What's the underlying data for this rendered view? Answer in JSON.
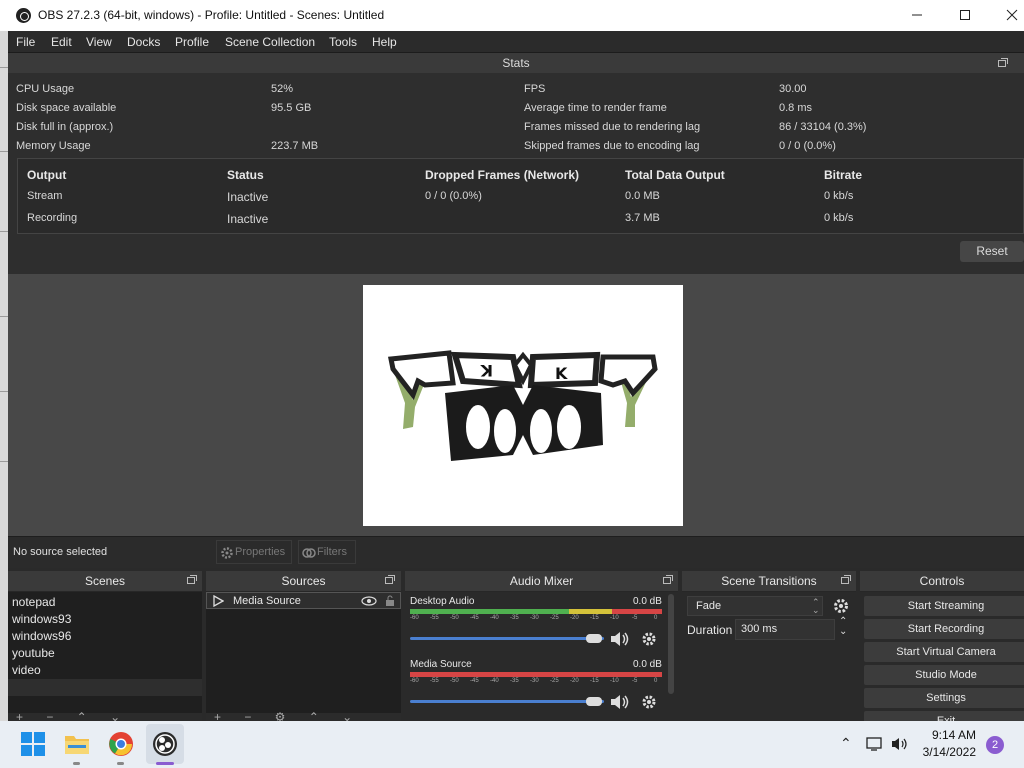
{
  "window": {
    "title": "OBS 27.2.3 (64-bit, windows) - Profile: Untitled - Scenes: Untitled"
  },
  "menu": [
    "File",
    "Edit",
    "View",
    "Docks",
    "Profile",
    "Scene Collection",
    "Tools",
    "Help"
  ],
  "stats": {
    "header": "Stats",
    "left": [
      {
        "label": "CPU Usage",
        "value": "52%"
      },
      {
        "label": "Disk space available",
        "value": "95.5 GB"
      },
      {
        "label": "Disk full in (approx.)",
        "value": ""
      },
      {
        "label": "Memory Usage",
        "value": "223.7 MB"
      }
    ],
    "right": [
      {
        "label": "FPS",
        "value": "30.00"
      },
      {
        "label": "Average time to render frame",
        "value": "0.8 ms"
      },
      {
        "label": "Frames missed due to rendering lag",
        "value": "86 / 33104 (0.3%)"
      },
      {
        "label": "Skipped frames due to encoding lag",
        "value": "0 / 0 (0.0%)"
      }
    ],
    "table": {
      "headers": [
        "Output",
        "Status",
        "Dropped Frames (Network)",
        "Total Data Output",
        "Bitrate"
      ],
      "rows": [
        [
          "Stream",
          "Inactive",
          "0 / 0 (0.0%)",
          "0.0 MB",
          "0 kb/s"
        ],
        [
          "Recording",
          "Inactive",
          "",
          "3.7 MB",
          "0 kb/s"
        ]
      ]
    },
    "reset_label": "Reset"
  },
  "source_toolbar": {
    "no_source": "No source selected",
    "properties": "Properties",
    "filters": "Filters"
  },
  "scenes": {
    "title": "Scenes",
    "items": [
      "notepad",
      "windows93",
      "windows96",
      "youtube",
      "video"
    ],
    "selected": "video"
  },
  "sources": {
    "title": "Sources",
    "items": [
      {
        "name": "Media Source"
      }
    ]
  },
  "audio_mixer": {
    "title": "Audio Mixer",
    "channels": [
      {
        "name": "Desktop Audio",
        "db": "0.0 dB",
        "volume": 1.0
      },
      {
        "name": "Media Source",
        "db": "0.0 dB",
        "volume": 1.0
      }
    ],
    "scale": [
      "-60",
      "-55",
      "-50",
      "-45",
      "-40",
      "-35",
      "-30",
      "-25",
      "-20",
      "-15",
      "-10",
      "-5",
      "0"
    ]
  },
  "scene_transitions": {
    "title": "Scene Transitions",
    "transition": "Fade",
    "duration_label": "Duration",
    "duration_value": "300 ms"
  },
  "controls": {
    "title": "Controls",
    "buttons": [
      "Start Streaming",
      "Start Recording",
      "Start Virtual Camera",
      "Studio Mode",
      "Settings",
      "Exit"
    ]
  },
  "taskbar": {
    "time": "9:14 AM",
    "date": "3/14/2022",
    "notifications": "2"
  },
  "colors": {
    "accent": "#4a7fd0",
    "meter_green": "#4fb04f",
    "meter_yellow": "#d4c23a",
    "meter_red": "#d64545",
    "notif": "#8a5cd0"
  }
}
